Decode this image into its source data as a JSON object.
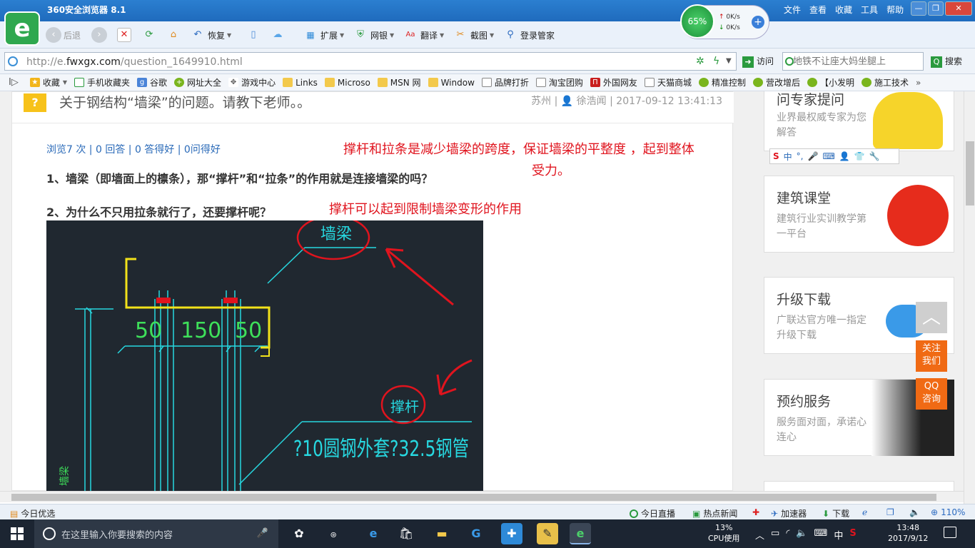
{
  "window": {
    "title": "360安全浏览器 8.1"
  },
  "speed": {
    "percent": "65%",
    "up": "0K/s",
    "down": "0K/s"
  },
  "menu": [
    "文件",
    "查看",
    "收藏",
    "工具",
    "帮助"
  ],
  "toolbar": {
    "back": "后退",
    "restore": "恢复",
    "extend": "扩展",
    "bank": "网银",
    "translate": "翻译",
    "screenshot": "截图",
    "login": "登录管家"
  },
  "address": {
    "url_prefix": "http://e.",
    "url_domain": "fwxgx.com",
    "url_path": "/question_1649910.html",
    "go": "访问"
  },
  "search": {
    "placeholder": "地铁不让座大妈坐腿上",
    "button": "搜索"
  },
  "bookmarks": [
    {
      "label": "收藏",
      "icon": "star"
    },
    {
      "label": "手机收藏夹",
      "icon": "page"
    },
    {
      "label": "谷歌",
      "icon": "g"
    },
    {
      "label": "网址大全",
      "icon": "green"
    },
    {
      "label": "游戏中心",
      "icon": "page"
    },
    {
      "label": "Links",
      "icon": "folder"
    },
    {
      "label": "Microso",
      "icon": "folder"
    },
    {
      "label": "MSN 网",
      "icon": "folder"
    },
    {
      "label": "Window",
      "icon": "folder"
    },
    {
      "label": "品牌打折",
      "icon": "page"
    },
    {
      "label": "淘宝团购",
      "icon": "page"
    },
    {
      "label": "外国网友",
      "icon": "red"
    },
    {
      "label": "天猫商城",
      "icon": "page"
    },
    {
      "label": "精准控制",
      "icon": "green"
    },
    {
      "label": "营改增后",
      "icon": "green"
    },
    {
      "label": "【小发明",
      "icon": "green"
    },
    {
      "label": "施工技术",
      "icon": "green"
    }
  ],
  "question": {
    "badge": "?",
    "title": "关于钢结构“墙梁”的问题。请教下老师。。",
    "location": "苏州",
    "user": "徐浩闻",
    "datetime": "2017-09-12 13:41:13",
    "stats": "浏览7 次 | 0 回答 | 0 答得好 | 0问得好",
    "line1": "1、墙梁（即墙面上的檩条），那“撑杆”和“拉条”的作用就是连接墙梁的吗？",
    "line2": "2、为什么不只用拉条就行了，还要撑杆呢？"
  },
  "annotations": {
    "note1_a": "撑杆和拉条是减少墙梁的跨度，保证墙梁的平整度 ，起到整体",
    "note1_b": "受力。",
    "note2": "撑杆可以起到限制墙梁变形的作用"
  },
  "cad": {
    "label_wallbeam": "墙梁",
    "dim_a": "50",
    "dim_b": "150",
    "dim_c": "50",
    "label_strut": "撑杆",
    "spec": "?10圆钢外套?32.5钢管",
    "label_side": "墙梁",
    "colors": {
      "bg": "#202830",
      "cyan": "#27d8e0",
      "yellow": "#f2e21a",
      "green": "#3ee05a",
      "red": "#e0141e"
    }
  },
  "sidebar": [
    {
      "title": "问专家提问",
      "desc": "业界最权威专家为您解答"
    },
    {
      "title": "建筑课堂",
      "desc": "建筑行业实训教学第一平台"
    },
    {
      "title": "升级下载",
      "desc": "广联达官方唯一指定升级下载"
    },
    {
      "title": "预约服务",
      "desc": "服务面对面，承诺心连心"
    }
  ],
  "ime": {
    "label": "中"
  },
  "float": {
    "follow": "关注\n我们",
    "qq": "QQ\n咨询"
  },
  "status": {
    "today": "今日优选",
    "live": "今日直播",
    "news": "热点新闻",
    "accel": "加速器",
    "download": "下载",
    "zoom": "110%"
  },
  "taskbar": {
    "search_placeholder": "在这里输入你要搜索的内容",
    "cpu_value": "13%",
    "cpu_label": "CPU使用",
    "ime": "中",
    "time": "13:48",
    "date": "2017/9/12"
  }
}
